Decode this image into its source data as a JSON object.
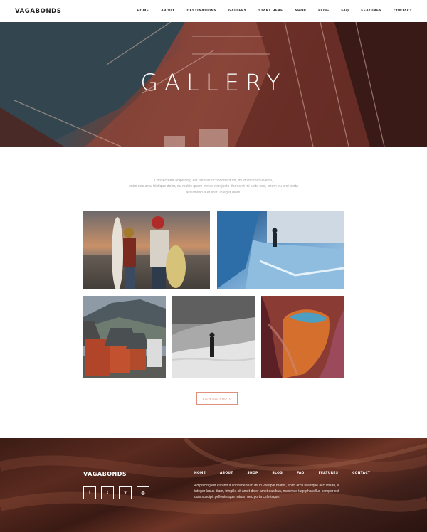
{
  "header": {
    "logo": "VAGABONDS",
    "nav": [
      "HOME",
      "ABOUT",
      "DESTINATIONS",
      "GALLERY",
      "START HERE",
      "SHOP",
      "BLOG",
      "FAQ",
      "FEATURES",
      "CONTACT"
    ]
  },
  "hero": {
    "title": "GALLERY"
  },
  "intro": {
    "line1": "Consectetur adipiscing elit curabitur condimentum, mi id volutpat viverra,",
    "line2": "enim nec arcu tristique dolor, eu mattis quam metus non justo donec et mi justo sed, lorem eu orci porta",
    "line3": "accumsan a et erat. Integer diam."
  },
  "gallery": {
    "photos": [
      "surfers-at-sunset",
      "ice-cave-explorer",
      "red-cabins-mountains",
      "desert-dunes-walker",
      "antelope-canyon"
    ],
    "view_all_label": "VIEW ALL PHOTO"
  },
  "footer": {
    "logo": "VAGABONDS",
    "nav": [
      "HOME",
      "ABOUT",
      "SHOP",
      "BLOG",
      "FAQ",
      "FEATURES",
      "CONTACT"
    ],
    "text": "Adipiscing elit curabitur condimentum mi id volutpat mattis, enim arcu ura tique accumsan, a integer lacus diam, fringilla sit amet dolor amet dapibus, maximus turp phasellus semper est quis suscipit pellentesque rutrum nec porta celerisque.",
    "socials": [
      {
        "icon": "facebook-icon",
        "glyph": "f"
      },
      {
        "icon": "twitter-icon",
        "glyph": "t"
      },
      {
        "icon": "vimeo-icon",
        "glyph": "v"
      },
      {
        "icon": "instagram-icon",
        "glyph": "◎"
      }
    ]
  },
  "colors": {
    "accent": "#e08f7d",
    "header_bg": "#ffffff",
    "footer_text": "#ffffff"
  }
}
